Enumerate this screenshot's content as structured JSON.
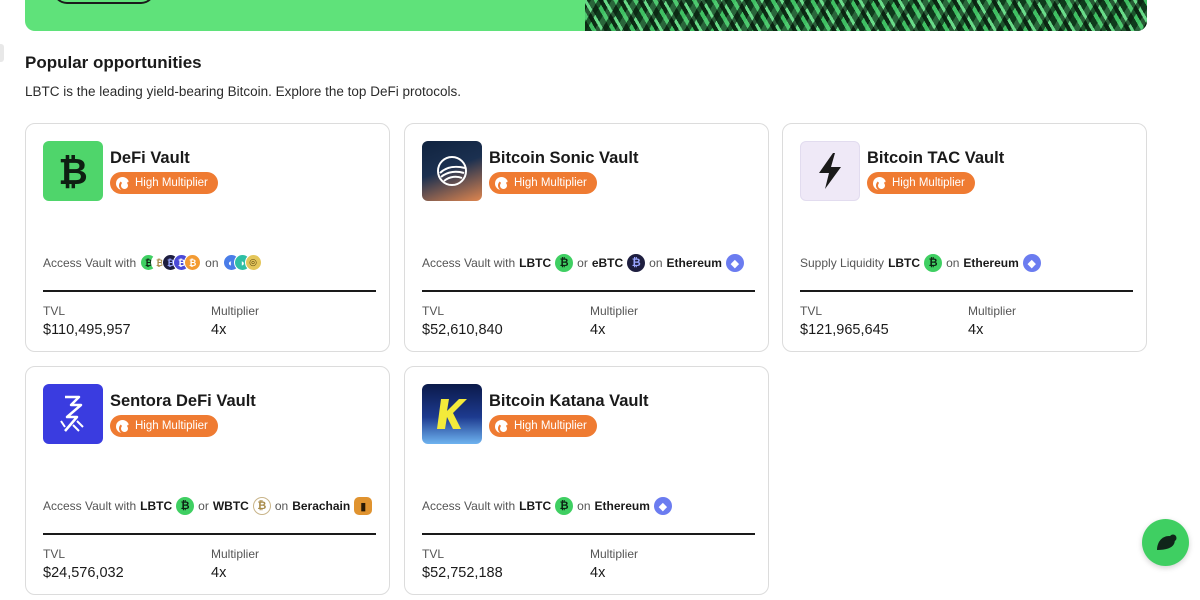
{
  "section": {
    "title": "Popular opportunities",
    "subtitle": "LBTC is the leading yield-bearing Bitcoin. Explore the top DeFi protocols."
  },
  "vaults": [
    {
      "name": "DeFi Vault",
      "badge": "High Multiplier",
      "access_prefix": "Access Vault with",
      "on_word": "on",
      "tvl_label": "TVL",
      "tvl": "$110,495,957",
      "multiplier_label": "Multiplier",
      "multiplier": "4x",
      "logo_icon": "bitcoin-green-logo"
    },
    {
      "name": "Bitcoin Sonic Vault",
      "badge": "High Multiplier",
      "access_prefix": "Access Vault with",
      "token_a": "LBTC",
      "or_word": "or",
      "token_b": "eBTC",
      "on_word": "on",
      "chain": "Ethereum",
      "tvl_label": "TVL",
      "tvl": "$52,610,840",
      "multiplier_label": "Multiplier",
      "multiplier": "4x",
      "logo_icon": "sonic-logo"
    },
    {
      "name": "Bitcoin TAC Vault",
      "badge": "High Multiplier",
      "access_prefix": "Supply Liquidity",
      "token_a": "LBTC",
      "on_word": "on",
      "chain": "Ethereum",
      "tvl_label": "TVL",
      "tvl": "$121,965,645",
      "multiplier_label": "Multiplier",
      "multiplier": "4x",
      "logo_icon": "tac-bolt-logo"
    },
    {
      "name": "Sentora DeFi Vault",
      "badge": "High Multiplier",
      "access_prefix": "Access Vault with",
      "token_a": "LBTC",
      "or_word": "or",
      "token_b": "WBTC",
      "on_word": "on",
      "chain": "Berachain",
      "tvl_label": "TVL",
      "tvl": "$24,576,032",
      "multiplier_label": "Multiplier",
      "multiplier": "4x",
      "logo_icon": "sentora-logo"
    },
    {
      "name": "Bitcoin Katana Vault",
      "badge": "High Multiplier",
      "access_prefix": "Access Vault with",
      "token_a": "LBTC",
      "on_word": "on",
      "chain": "Ethereum",
      "tvl_label": "TVL",
      "tvl": "$52,752,188",
      "multiplier_label": "Multiplier",
      "multiplier": "4x",
      "logo_icon": "katana-logo"
    }
  ],
  "colors": {
    "brand_green": "#5fe27a",
    "badge_orange": "#ef7b32",
    "eth_purple": "#6b7cf0"
  }
}
